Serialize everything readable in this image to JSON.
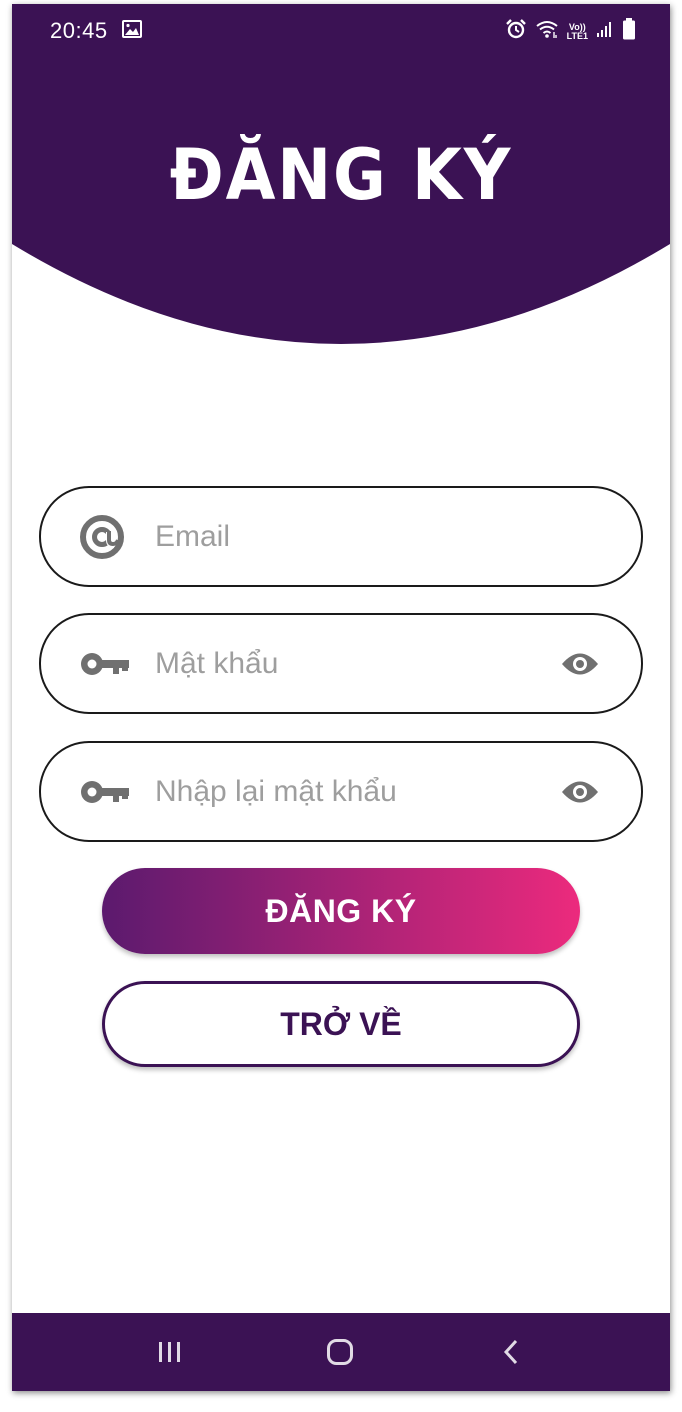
{
  "colors": {
    "brand": "#3b1254",
    "gradient_start": "#5b1a6e",
    "gradient_end": "#ec2a7d",
    "placeholder": "#9e9e9e",
    "icon_gray": "#707070"
  },
  "status_bar": {
    "time": "20:45",
    "volte_top": "Vo))",
    "volte_bottom": "LTE1"
  },
  "header": {
    "title": "ĐĂNG KÝ"
  },
  "form": {
    "email": {
      "placeholder": "Email",
      "value": "",
      "icon": "at-icon"
    },
    "password": {
      "placeholder": "Mật khẩu",
      "value": "",
      "icon": "key-icon",
      "toggle_icon": "eye-icon"
    },
    "confirm_password": {
      "placeholder": "Nhập lại mật khẩu",
      "value": "",
      "icon": "key-icon",
      "toggle_icon": "eye-icon"
    }
  },
  "buttons": {
    "register": "ĐĂNG KÝ",
    "back": "TRỞ VỀ"
  },
  "navbar": {
    "icons": [
      "recent-apps-icon",
      "home-icon",
      "back-icon"
    ]
  }
}
